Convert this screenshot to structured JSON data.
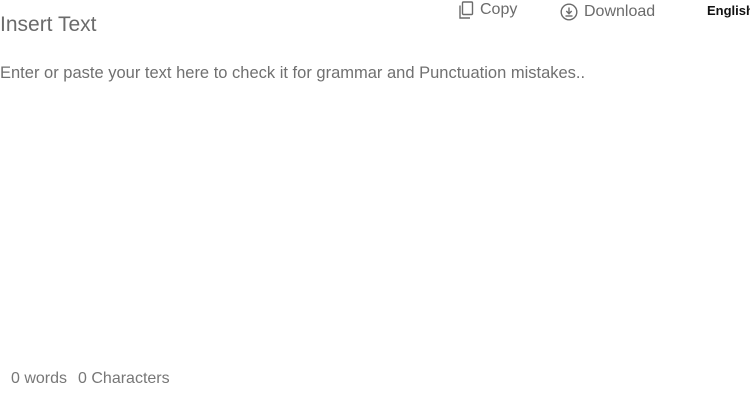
{
  "header": {
    "title": "Insert Text"
  },
  "toolbar": {
    "copy": {
      "label": "Copy",
      "icon": "copy-icon"
    },
    "download": {
      "label": "Download",
      "icon": "download-icon"
    },
    "language": {
      "selected": "English"
    }
  },
  "editor": {
    "value": "",
    "placeholder": "Enter or paste your text here to check it for grammar and Punctuation mistakes.."
  },
  "footer": {
    "words": "0 words",
    "characters": "0 Characters"
  },
  "colors": {
    "text_muted": "#6b6b6b",
    "text_dark": "#111111",
    "background": "#ffffff"
  }
}
